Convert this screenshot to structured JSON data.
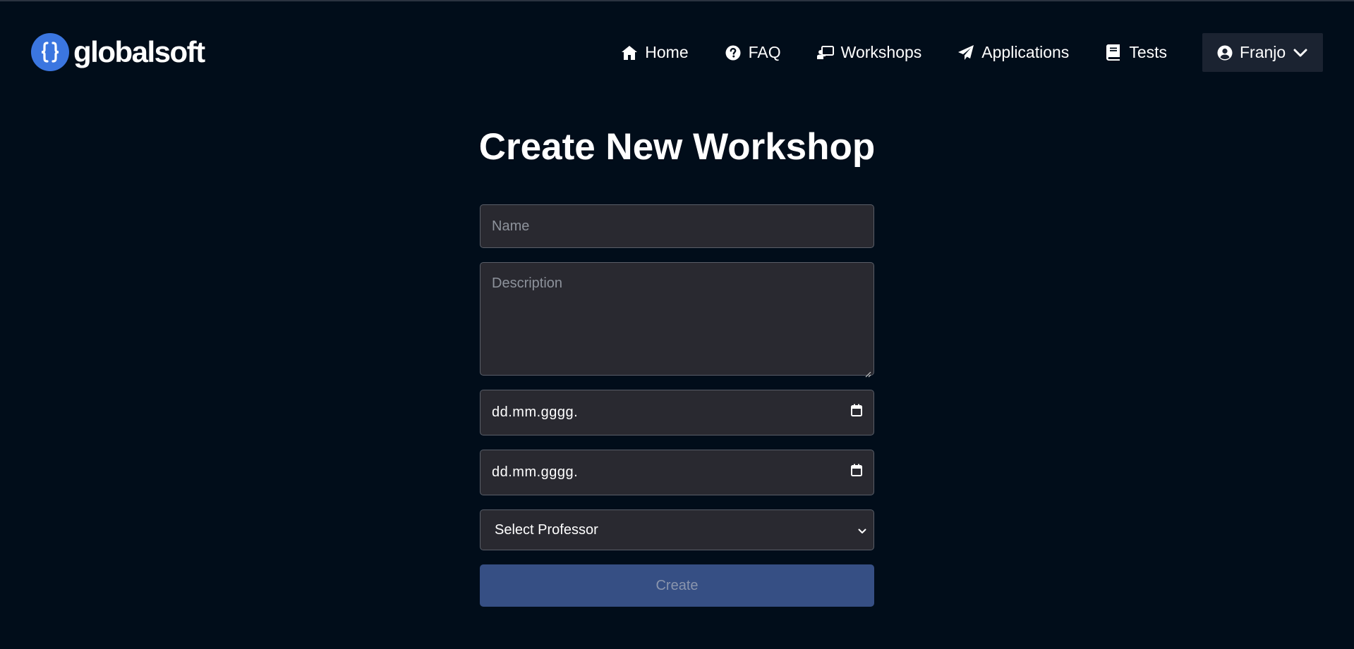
{
  "brand": {
    "name": "globalsoft",
    "accent": "#3b76e0"
  },
  "nav": {
    "items": [
      {
        "label": "Home",
        "icon": "home-icon"
      },
      {
        "label": "FAQ",
        "icon": "question-circle-icon"
      },
      {
        "label": "Workshops",
        "icon": "chalkboard-teacher-icon"
      },
      {
        "label": "Applications",
        "icon": "paper-plane-icon"
      },
      {
        "label": "Tests",
        "icon": "book-icon"
      }
    ],
    "user": {
      "label": "Franjo",
      "icon": "user-circle-icon"
    }
  },
  "page": {
    "title": "Create New Workshop"
  },
  "form": {
    "name_placeholder": "Name",
    "description_placeholder": "Description",
    "start_date_value": "dd.mm.gggg.",
    "end_date_value": "dd.mm.gggg.",
    "professor_select": "Select Professor",
    "submit_label": "Create"
  }
}
